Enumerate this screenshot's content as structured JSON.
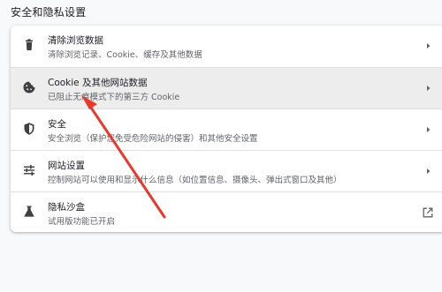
{
  "section_title": "安全和隐私设置",
  "items": [
    {
      "label": "清除浏览数据",
      "desc": "清除浏览记录、Cookie、缓存及其他数据",
      "icon": "trash-icon",
      "action": "chevron-right-icon"
    },
    {
      "label": "Cookie 及其他网站数据",
      "desc": "已阻止无痕模式下的第三方 Cookie",
      "icon": "cookie-icon",
      "action": "chevron-right-icon"
    },
    {
      "label": "安全",
      "desc": "安全浏览（保护您免受危险网站的侵害）和其他安全设置",
      "icon": "shield-icon",
      "action": "chevron-right-icon"
    },
    {
      "label": "网站设置",
      "desc": "控制网站可以使用和显示什么信息（如位置信息、摄像头、弹出式窗口及其他）",
      "icon": "sliders-icon",
      "action": "chevron-right-icon"
    },
    {
      "label": "隐私沙盒",
      "desc": "试用版功能已开启",
      "icon": "flask-icon",
      "action": "external-link-icon"
    }
  ],
  "colors": {
    "icon": "#3c4043",
    "highlight_row": "#ededed",
    "annotation_arrow": "#e8392b"
  }
}
